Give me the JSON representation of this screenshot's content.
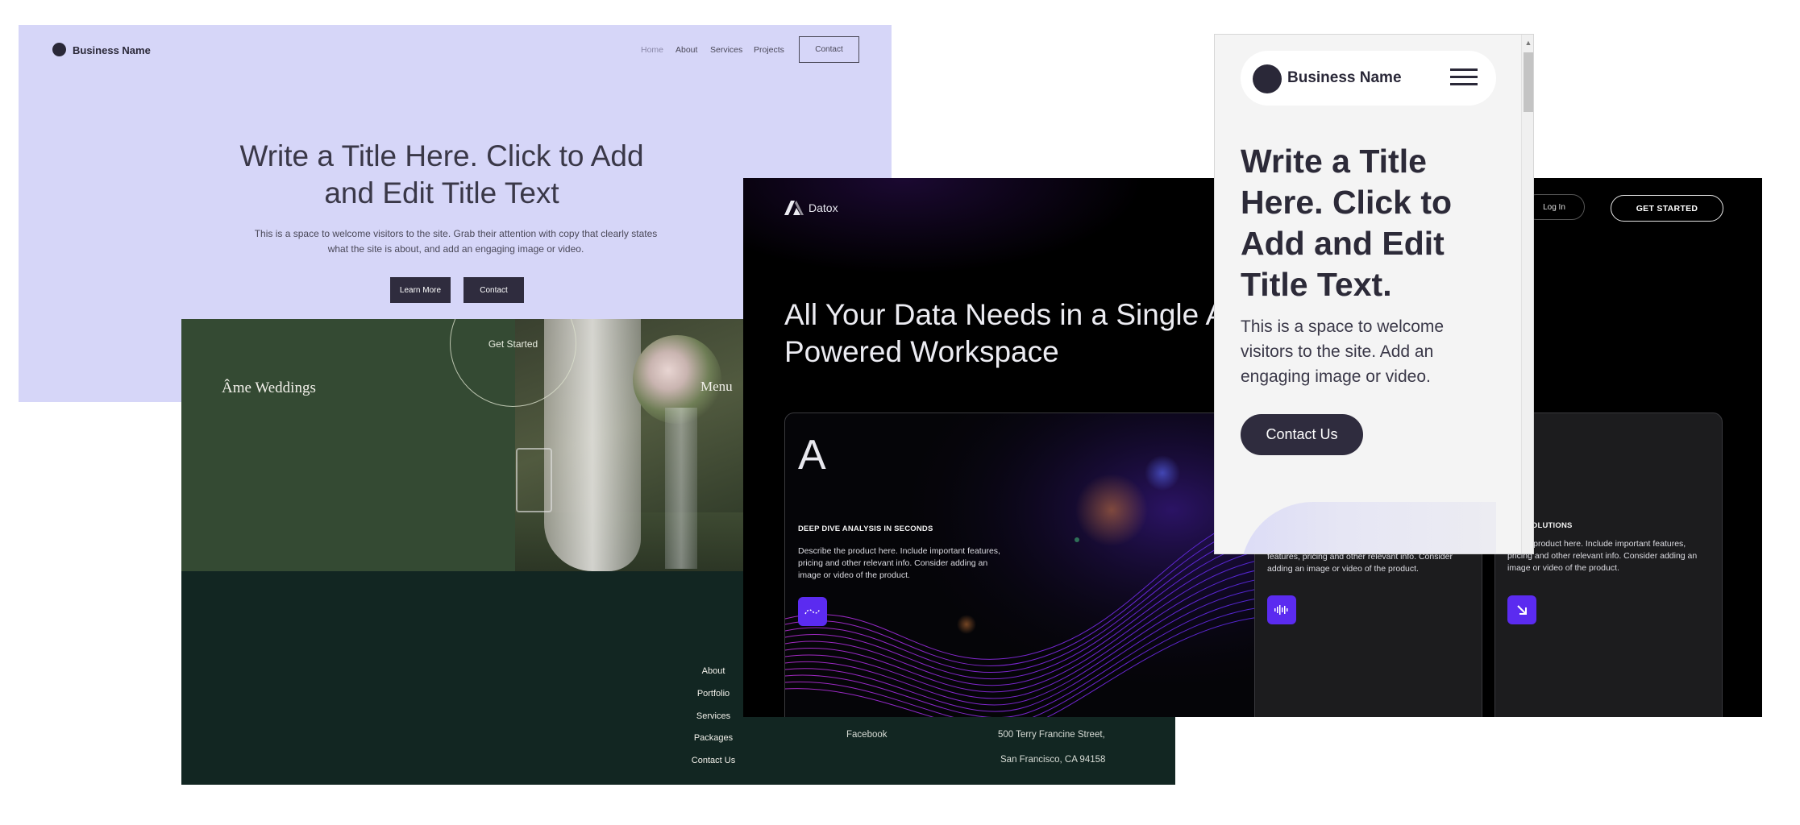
{
  "site1": {
    "brand": "Business Name",
    "nav": [
      "Home",
      "About",
      "Services",
      "Projects"
    ],
    "nav_contact": "Contact",
    "title": "Write a Title Here. Click to Add and Edit Title Text",
    "subtitle": "This is a space to welcome visitors to the site. Grab their attention with copy that clearly states what the site is about, and add an engaging image or video.",
    "learn_more": "Learn More",
    "contact": "Contact"
  },
  "site2": {
    "get_started": "Get Started",
    "brand": "Âme Weddings",
    "menu_title": "Menu",
    "menu_items": [
      "About",
      "Portfolio",
      "Services",
      "Packages",
      "Contact Us"
    ],
    "social": "Facebook",
    "address_line1": "500 Terry Francine Street,",
    "address_line2": "San Francisco, CA 94158"
  },
  "site3": {
    "brand": "Datox",
    "login": "Log In",
    "get_started": "GET STARTED",
    "hero": "All Your Data Needs in a Single AI-Powered Workspace",
    "cards": [
      {
        "letter": "A",
        "title": "DEEP DIVE ANALYSIS IN SECONDS",
        "desc": "Describe the product here. Include important features, pricing and other relevant info. Consider adding an image or video of the product.",
        "icon": "wave-icon"
      },
      {
        "title": "",
        "desc": "features, pricing and other relevant info. Consider adding an image or video of the product.",
        "icon": "audio-bars-icon"
      },
      {
        "title": "M AI SOLUTIONS",
        "desc": "be the product here. Include important features, pricing and other relevant info. Consider adding an image or video of the product.",
        "icon": "arrow-down-right-icon"
      }
    ],
    "accent": "#5b2bf0"
  },
  "site4": {
    "brand": "Business Name",
    "title": "Write a Title Here. Click to Add and Edit Title Text.",
    "desc": "This is a space to welcome visitors to the site. Add an engaging image or video.",
    "cta": "Contact Us"
  }
}
